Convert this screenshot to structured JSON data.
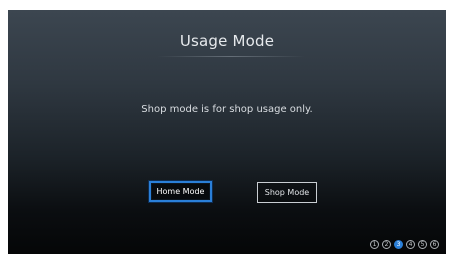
{
  "screen": {
    "title": "Usage Mode",
    "message": "Shop mode is for shop usage only."
  },
  "buttons": {
    "home": "Home Mode",
    "shop": "Shop Mode"
  },
  "steps": {
    "items": [
      "1",
      "2",
      "3",
      "4",
      "5",
      "6"
    ],
    "current": 3
  },
  "colors": {
    "focus": "#2a7fd8"
  }
}
